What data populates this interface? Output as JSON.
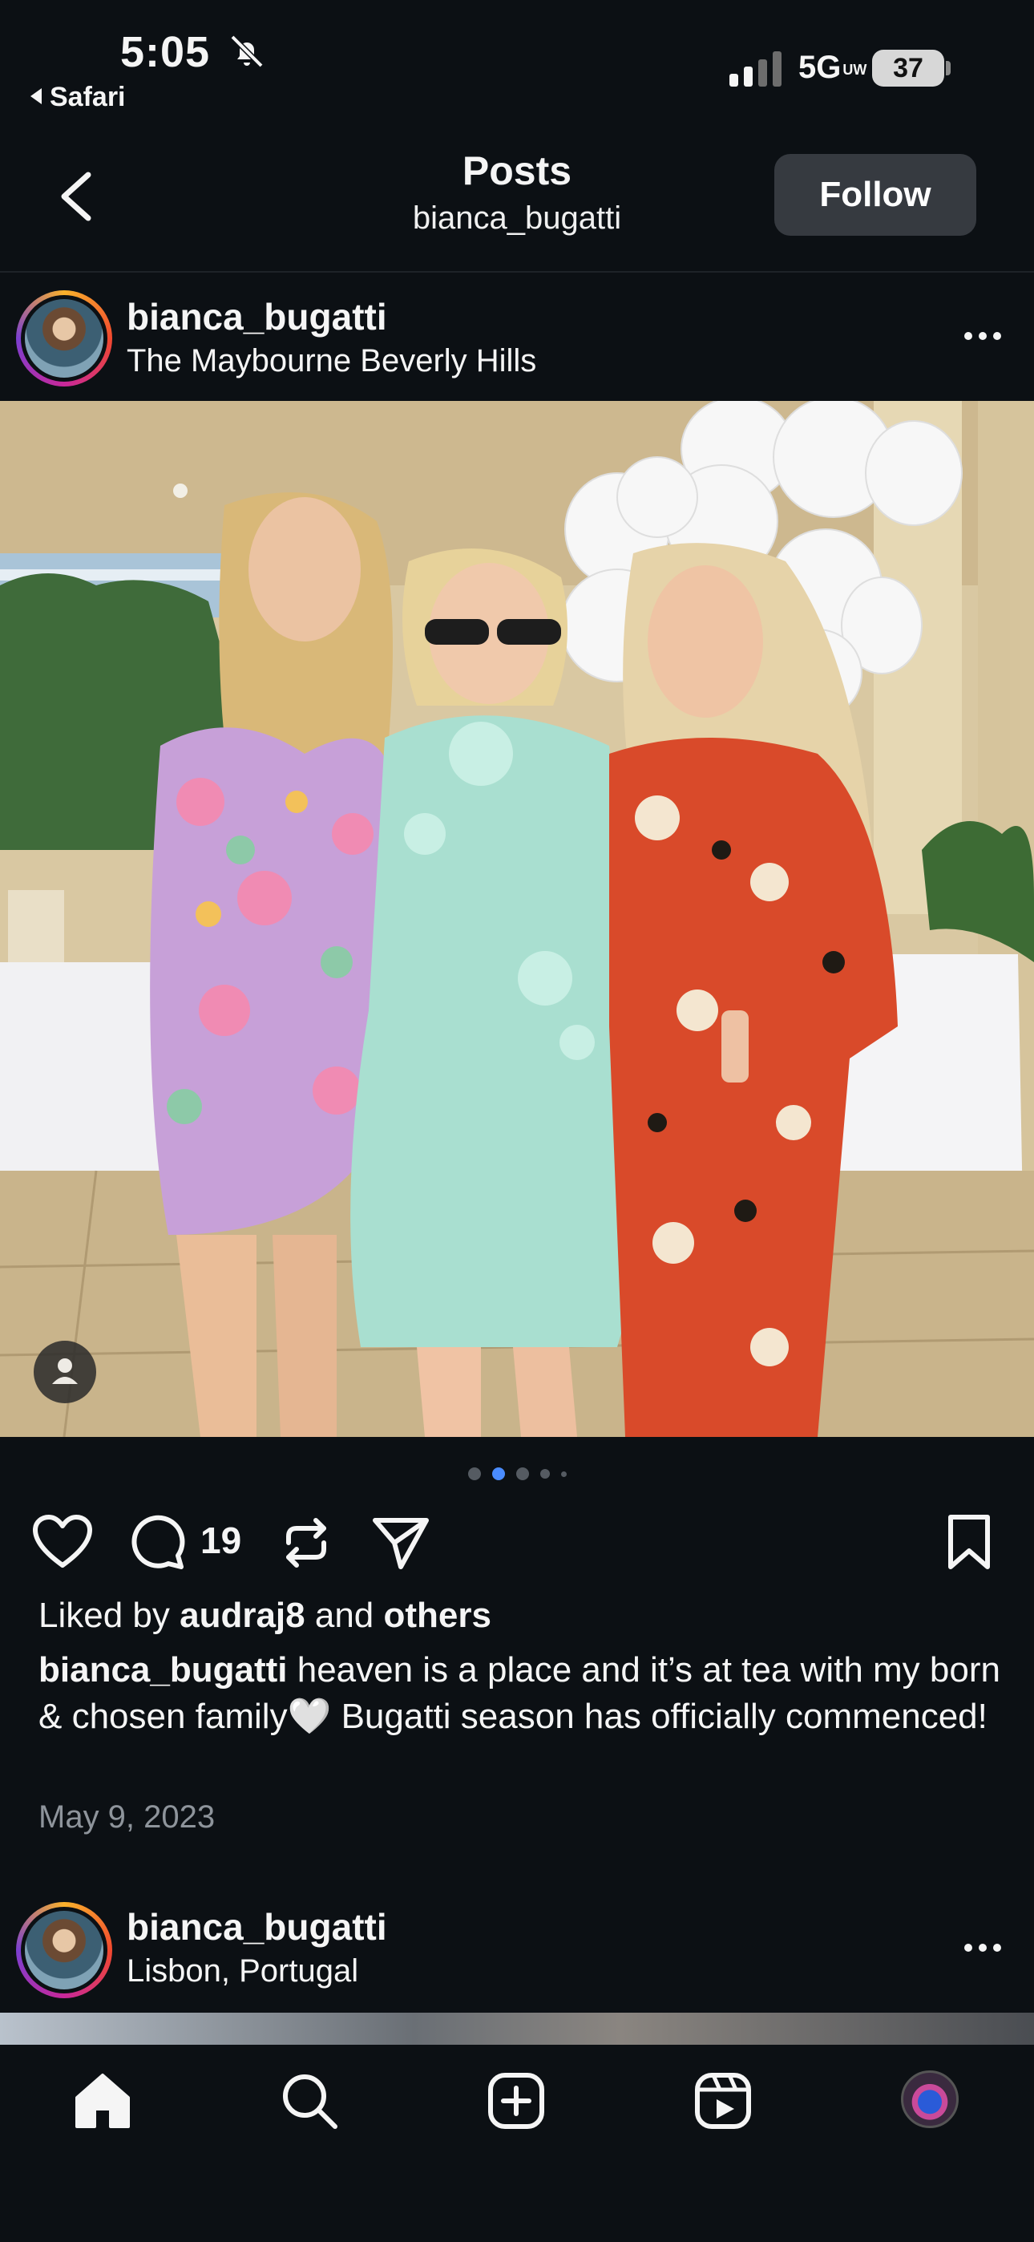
{
  "status_bar": {
    "time": "5:05",
    "back_app": "Safari",
    "network": "5G",
    "network_sub": "UW",
    "battery": "37"
  },
  "header": {
    "title": "Posts",
    "subtitle": "bianca_bugatti",
    "follow_label": "Follow"
  },
  "post": {
    "username": "bianca_bugatti",
    "location": "The Maybourne Beverly Hills",
    "carousel": {
      "count": 5,
      "active": 2
    },
    "comment_count": "19",
    "likes_prefix": "Liked by ",
    "likes_user": "audraj8",
    "likes_mid": " and ",
    "likes_others": "others",
    "caption_user": "bianca_bugatti",
    "caption_text": " heaven is a place and it’s at tea with my born & chosen family🤍 Bugatti season has officially commenced!",
    "date": "May 9, 2023"
  },
  "next_post": {
    "username": "bianca_bugatti",
    "location": "Lisbon, Portugal"
  },
  "colors": {
    "background": "#0c1014",
    "follow_button": "#363a40",
    "active_dot": "#4a8cff",
    "muted_text": "#8e949b"
  },
  "icons": [
    "bell-off-icon",
    "signal-icon",
    "back-chevron-icon",
    "more-icon",
    "heart-icon",
    "comment-icon",
    "repost-icon",
    "share-icon",
    "bookmark-icon",
    "home-icon",
    "search-icon",
    "create-icon",
    "reels-icon",
    "profile-icon",
    "user-tag-icon"
  ]
}
